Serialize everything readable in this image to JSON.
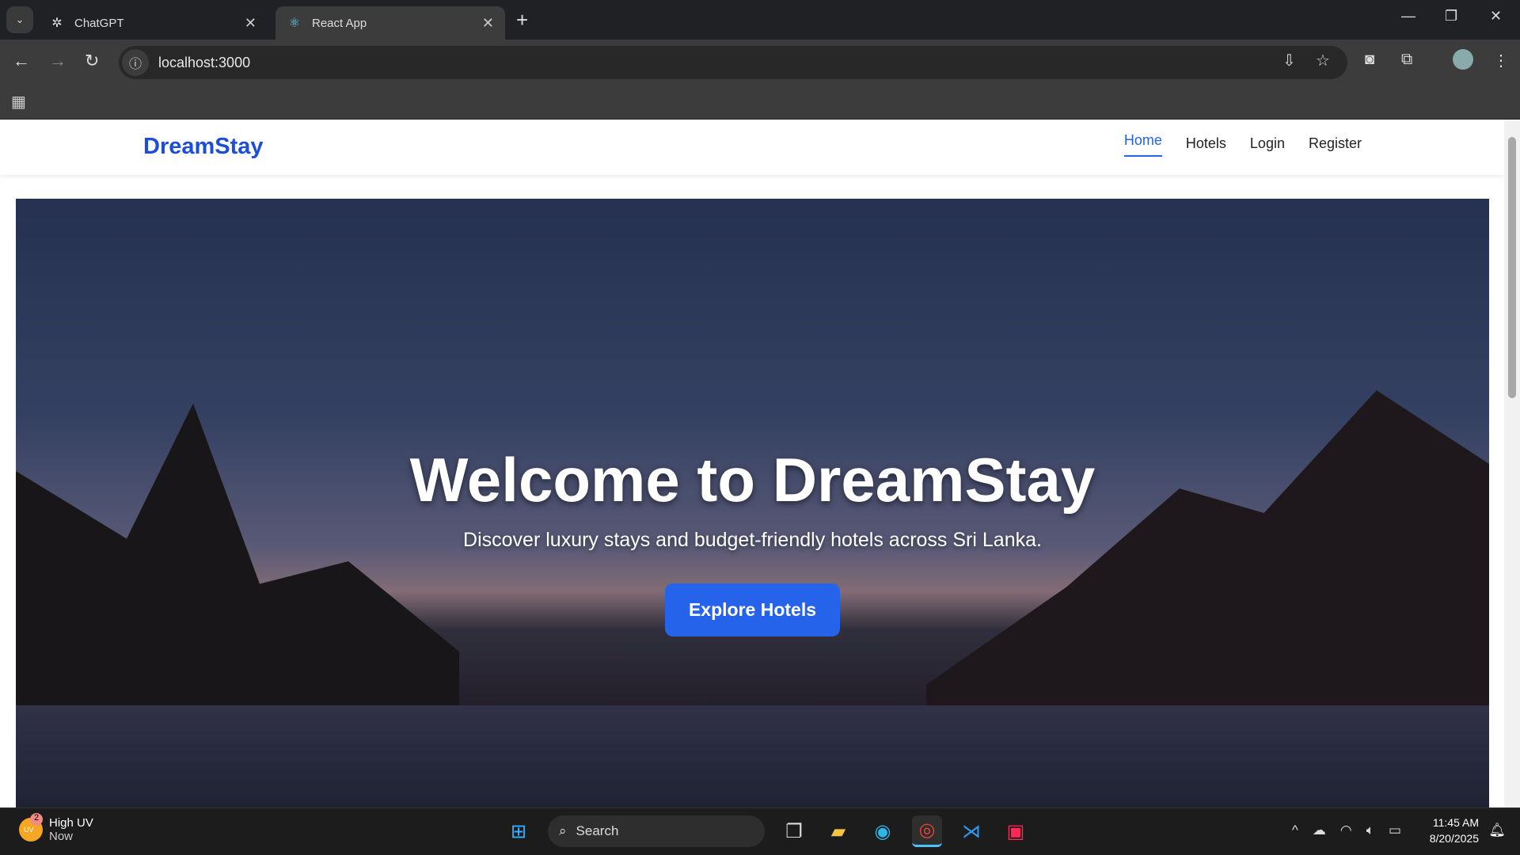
{
  "browser": {
    "tabs": [
      {
        "title": "ChatGPT",
        "active": false
      },
      {
        "title": "React App",
        "active": true
      }
    ],
    "url": "localhost:3000"
  },
  "site": {
    "logo": "DreamStay",
    "nav": [
      {
        "label": "Home",
        "active": true
      },
      {
        "label": "Hotels"
      },
      {
        "label": "Login"
      },
      {
        "label": "Register"
      }
    ],
    "hero": {
      "title": "Welcome to DreamStay",
      "subtitle": "Discover luxury stays and budget-friendly hotels across Sri Lanka.",
      "cta": "Explore Hotels"
    },
    "colors": {
      "brand": "#1d4ed8",
      "accent": "#2563eb"
    }
  },
  "taskbar": {
    "weather": {
      "title": "High UV",
      "subtitle": "Now",
      "badge": "2",
      "icon_text": "UV"
    },
    "search_placeholder": "Search",
    "time": "11:45 AM",
    "date": "8/20/2025"
  }
}
